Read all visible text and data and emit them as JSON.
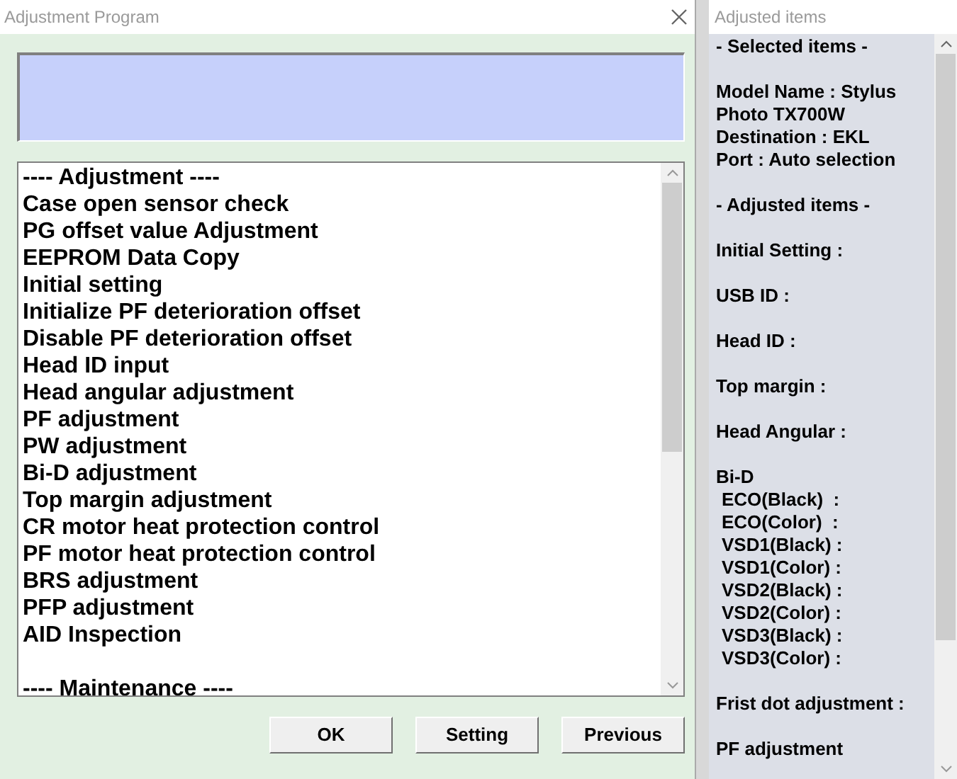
{
  "dialog": {
    "title": "Adjustment Program",
    "list": {
      "groups": [
        {
          "heading": "---- Adjustment ----",
          "items": [
            "Case open sensor check",
            "PG offset value Adjustment",
            "EEPROM Data Copy",
            "Initial setting",
            "Initialize PF deterioration offset",
            "Disable PF deterioration offset",
            "Head ID input",
            "Head angular adjustment",
            "PF adjustment",
            "PW adjustment",
            "Bi-D adjustment",
            "Top margin adjustment",
            "CR motor heat protection control",
            "PF motor heat protection control",
            "BRS adjustment",
            "PFP adjustment",
            "AID Inspection"
          ]
        },
        {
          "heading": "---- Maintenance ----"
        }
      ]
    },
    "buttons": [
      "OK",
      "Setting",
      "Previous"
    ]
  },
  "side_window": {
    "title": "Adjusted items",
    "blocks": [
      [
        {
          "text": "- Selected items -",
          "indent": false
        }
      ],
      [
        {
          "text": "Model Name : Stylus Photo TX700W",
          "indent": false
        },
        {
          "text": "Destination : EKL",
          "indent": false
        },
        {
          "text": "Port : Auto selection",
          "indent": false
        }
      ],
      [
        {
          "text": "- Adjusted items -",
          "indent": false
        }
      ],
      [
        {
          "text": "Initial Setting :",
          "indent": false
        }
      ],
      [
        {
          "text": "USB ID :",
          "indent": false
        }
      ],
      [
        {
          "text": "Head ID :",
          "indent": false
        }
      ],
      [
        {
          "text": "Top margin :",
          "indent": false
        }
      ],
      [
        {
          "text": "Head Angular :",
          "indent": false
        }
      ],
      [
        {
          "text": "Bi-D",
          "indent": false
        },
        {
          "text": "ECO(Black)  :",
          "indent": true
        },
        {
          "text": "ECO(Color)  :",
          "indent": true
        },
        {
          "text": "VSD1(Black) :",
          "indent": true
        },
        {
          "text": "VSD1(Color) :",
          "indent": true
        },
        {
          "text": "VSD2(Black) :",
          "indent": true
        },
        {
          "text": "VSD2(Color) :",
          "indent": true
        },
        {
          "text": "VSD3(Black) :",
          "indent": true
        },
        {
          "text": "VSD3(Color) :",
          "indent": true
        }
      ],
      [
        {
          "text": "Frist dot adjustment :",
          "indent": false
        }
      ],
      [
        {
          "text": "PF adjustment",
          "indent": false
        }
      ]
    ]
  }
}
